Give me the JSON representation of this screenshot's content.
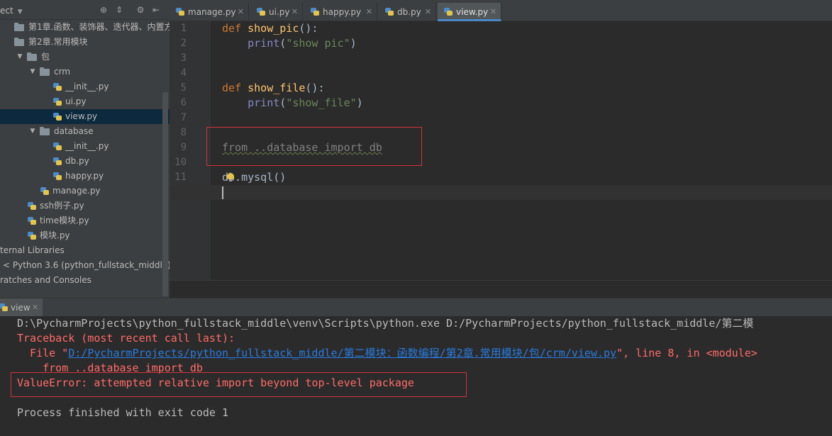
{
  "project_panel": {
    "title": "ect",
    "tree": [
      {
        "label": "第1章.函数、装饰器、迭代器、内置方法",
        "indent": 20,
        "kind": "folder",
        "selected": false
      },
      {
        "label": "第2章.常用模块",
        "indent": 20,
        "kind": "folder",
        "selected": false
      },
      {
        "label": "包",
        "indent": 38,
        "kind": "folder",
        "arrow": "▼",
        "selected": false
      },
      {
        "label": "crm",
        "indent": 56,
        "kind": "folder",
        "arrow": "▼",
        "selected": false
      },
      {
        "label": "__init__.py",
        "indent": 74,
        "kind": "py",
        "selected": false
      },
      {
        "label": "ui.py",
        "indent": 74,
        "kind": "py",
        "selected": false
      },
      {
        "label": "view.py",
        "indent": 74,
        "kind": "py",
        "selected": true
      },
      {
        "label": "database",
        "indent": 56,
        "kind": "folder",
        "arrow": "▼",
        "selected": false
      },
      {
        "label": "__init__.py",
        "indent": 74,
        "kind": "py",
        "selected": false
      },
      {
        "label": "db.py",
        "indent": 74,
        "kind": "py",
        "selected": false
      },
      {
        "label": "happy.py",
        "indent": 74,
        "kind": "py",
        "selected": false
      },
      {
        "label": "manage.py",
        "indent": 56,
        "kind": "py",
        "selected": false
      },
      {
        "label": "ssh例子.py",
        "indent": 38,
        "kind": "py",
        "selected": false
      },
      {
        "label": "time模块.py",
        "indent": 38,
        "kind": "py",
        "selected": false
      },
      {
        "label": "模块.py",
        "indent": 38,
        "kind": "py",
        "selected": false
      },
      {
        "label": "ternal Libraries",
        "indent": 0,
        "kind": "text",
        "selected": false
      },
      {
        "label": "< Python 3.6 (python_fullstack_middle) >",
        "indent": 4,
        "kind": "text",
        "selected": false
      },
      {
        "label": "ratches and Consoles",
        "indent": 0,
        "kind": "text",
        "selected": false
      }
    ]
  },
  "editor": {
    "tabs": [
      {
        "label": "manage.py",
        "active": false
      },
      {
        "label": "ui.py",
        "active": false
      },
      {
        "label": "happy.py",
        "active": false
      },
      {
        "label": "db.py",
        "active": false
      },
      {
        "label": "view.py",
        "active": true
      }
    ],
    "line_numbers": [
      "1",
      "2",
      "3",
      "4",
      "5",
      "6",
      "7",
      "8",
      "9",
      "10",
      "11",
      "12"
    ],
    "code": [
      [
        {
          "t": "def ",
          "c": "kw"
        },
        {
          "t": "show_pic",
          "c": "fn"
        },
        {
          "t": "():",
          "c": "plain"
        }
      ],
      [
        {
          "t": "    ",
          "c": "plain"
        },
        {
          "t": "print",
          "c": "bi"
        },
        {
          "t": "(",
          "c": "plain"
        },
        {
          "t": "\"show pic\"",
          "c": "str"
        },
        {
          "t": ")",
          "c": "plain"
        }
      ],
      [],
      [],
      [
        {
          "t": "def ",
          "c": "kw"
        },
        {
          "t": "show_file",
          "c": "fn"
        },
        {
          "t": "():",
          "c": "plain"
        }
      ],
      [
        {
          "t": "    ",
          "c": "plain"
        },
        {
          "t": "print",
          "c": "bi"
        },
        {
          "t": "(",
          "c": "plain"
        },
        {
          "t": "\"show_file\"",
          "c": "str"
        },
        {
          "t": ")",
          "c": "plain"
        }
      ],
      [],
      [],
      [
        {
          "t": "from ..database import db",
          "c": "unused"
        }
      ],
      [],
      [
        {
          "t": "db.mysql()",
          "c": "plain"
        }
      ],
      []
    ]
  },
  "run_panel": {
    "tab_label": "view",
    "lines": [
      [
        {
          "t": "D:\\PycharmProjects\\python_fullstack_middle\\venv\\Scripts\\python.exe D:/PycharmProjects/python_fullstack_middle/第二模",
          "c": "con-plain"
        }
      ],
      [
        {
          "t": "Traceback (most recent call last):",
          "c": "con-err"
        }
      ],
      [
        {
          "t": "  File \"",
          "c": "con-err"
        },
        {
          "t": "D:/PycharmProjects/python_fullstack_middle/第二模块：函数编程/第2章.常用模块/包/crm/view.py",
          "c": "con-link"
        },
        {
          "t": "\", line 8, in <module>",
          "c": "con-err"
        }
      ],
      [
        {
          "t": "    from ..database import db",
          "c": "con-err"
        }
      ],
      [
        {
          "t": "ValueError: attempted relative import beyond top-level package",
          "c": "con-err"
        }
      ],
      [],
      [
        {
          "t": "Process finished with exit code 1",
          "c": "con-plain"
        }
      ]
    ]
  },
  "colors": {
    "highlight_box": "#d2333b",
    "accent": "#4a88c7"
  }
}
